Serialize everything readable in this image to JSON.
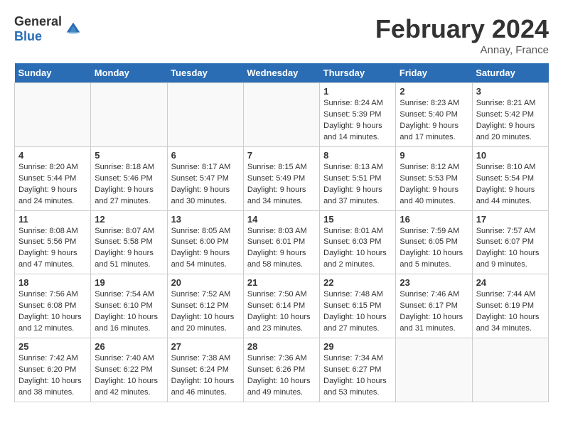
{
  "header": {
    "logo_general": "General",
    "logo_blue": "Blue",
    "title": "February 2024",
    "location": "Annay, France"
  },
  "columns": [
    "Sunday",
    "Monday",
    "Tuesday",
    "Wednesday",
    "Thursday",
    "Friday",
    "Saturday"
  ],
  "weeks": [
    [
      {
        "day": "",
        "info": ""
      },
      {
        "day": "",
        "info": ""
      },
      {
        "day": "",
        "info": ""
      },
      {
        "day": "",
        "info": ""
      },
      {
        "day": "1",
        "info": "Sunrise: 8:24 AM\nSunset: 5:39 PM\nDaylight: 9 hours\nand 14 minutes."
      },
      {
        "day": "2",
        "info": "Sunrise: 8:23 AM\nSunset: 5:40 PM\nDaylight: 9 hours\nand 17 minutes."
      },
      {
        "day": "3",
        "info": "Sunrise: 8:21 AM\nSunset: 5:42 PM\nDaylight: 9 hours\nand 20 minutes."
      }
    ],
    [
      {
        "day": "4",
        "info": "Sunrise: 8:20 AM\nSunset: 5:44 PM\nDaylight: 9 hours\nand 24 minutes."
      },
      {
        "day": "5",
        "info": "Sunrise: 8:18 AM\nSunset: 5:46 PM\nDaylight: 9 hours\nand 27 minutes."
      },
      {
        "day": "6",
        "info": "Sunrise: 8:17 AM\nSunset: 5:47 PM\nDaylight: 9 hours\nand 30 minutes."
      },
      {
        "day": "7",
        "info": "Sunrise: 8:15 AM\nSunset: 5:49 PM\nDaylight: 9 hours\nand 34 minutes."
      },
      {
        "day": "8",
        "info": "Sunrise: 8:13 AM\nSunset: 5:51 PM\nDaylight: 9 hours\nand 37 minutes."
      },
      {
        "day": "9",
        "info": "Sunrise: 8:12 AM\nSunset: 5:53 PM\nDaylight: 9 hours\nand 40 minutes."
      },
      {
        "day": "10",
        "info": "Sunrise: 8:10 AM\nSunset: 5:54 PM\nDaylight: 9 hours\nand 44 minutes."
      }
    ],
    [
      {
        "day": "11",
        "info": "Sunrise: 8:08 AM\nSunset: 5:56 PM\nDaylight: 9 hours\nand 47 minutes."
      },
      {
        "day": "12",
        "info": "Sunrise: 8:07 AM\nSunset: 5:58 PM\nDaylight: 9 hours\nand 51 minutes."
      },
      {
        "day": "13",
        "info": "Sunrise: 8:05 AM\nSunset: 6:00 PM\nDaylight: 9 hours\nand 54 minutes."
      },
      {
        "day": "14",
        "info": "Sunrise: 8:03 AM\nSunset: 6:01 PM\nDaylight: 9 hours\nand 58 minutes."
      },
      {
        "day": "15",
        "info": "Sunrise: 8:01 AM\nSunset: 6:03 PM\nDaylight: 10 hours\nand 2 minutes."
      },
      {
        "day": "16",
        "info": "Sunrise: 7:59 AM\nSunset: 6:05 PM\nDaylight: 10 hours\nand 5 minutes."
      },
      {
        "day": "17",
        "info": "Sunrise: 7:57 AM\nSunset: 6:07 PM\nDaylight: 10 hours\nand 9 minutes."
      }
    ],
    [
      {
        "day": "18",
        "info": "Sunrise: 7:56 AM\nSunset: 6:08 PM\nDaylight: 10 hours\nand 12 minutes."
      },
      {
        "day": "19",
        "info": "Sunrise: 7:54 AM\nSunset: 6:10 PM\nDaylight: 10 hours\nand 16 minutes."
      },
      {
        "day": "20",
        "info": "Sunrise: 7:52 AM\nSunset: 6:12 PM\nDaylight: 10 hours\nand 20 minutes."
      },
      {
        "day": "21",
        "info": "Sunrise: 7:50 AM\nSunset: 6:14 PM\nDaylight: 10 hours\nand 23 minutes."
      },
      {
        "day": "22",
        "info": "Sunrise: 7:48 AM\nSunset: 6:15 PM\nDaylight: 10 hours\nand 27 minutes."
      },
      {
        "day": "23",
        "info": "Sunrise: 7:46 AM\nSunset: 6:17 PM\nDaylight: 10 hours\nand 31 minutes."
      },
      {
        "day": "24",
        "info": "Sunrise: 7:44 AM\nSunset: 6:19 PM\nDaylight: 10 hours\nand 34 minutes."
      }
    ],
    [
      {
        "day": "25",
        "info": "Sunrise: 7:42 AM\nSunset: 6:20 PM\nDaylight: 10 hours\nand 38 minutes."
      },
      {
        "day": "26",
        "info": "Sunrise: 7:40 AM\nSunset: 6:22 PM\nDaylight: 10 hours\nand 42 minutes."
      },
      {
        "day": "27",
        "info": "Sunrise: 7:38 AM\nSunset: 6:24 PM\nDaylight: 10 hours\nand 46 minutes."
      },
      {
        "day": "28",
        "info": "Sunrise: 7:36 AM\nSunset: 6:26 PM\nDaylight: 10 hours\nand 49 minutes."
      },
      {
        "day": "29",
        "info": "Sunrise: 7:34 AM\nSunset: 6:27 PM\nDaylight: 10 hours\nand 53 minutes."
      },
      {
        "day": "",
        "info": ""
      },
      {
        "day": "",
        "info": ""
      }
    ]
  ]
}
